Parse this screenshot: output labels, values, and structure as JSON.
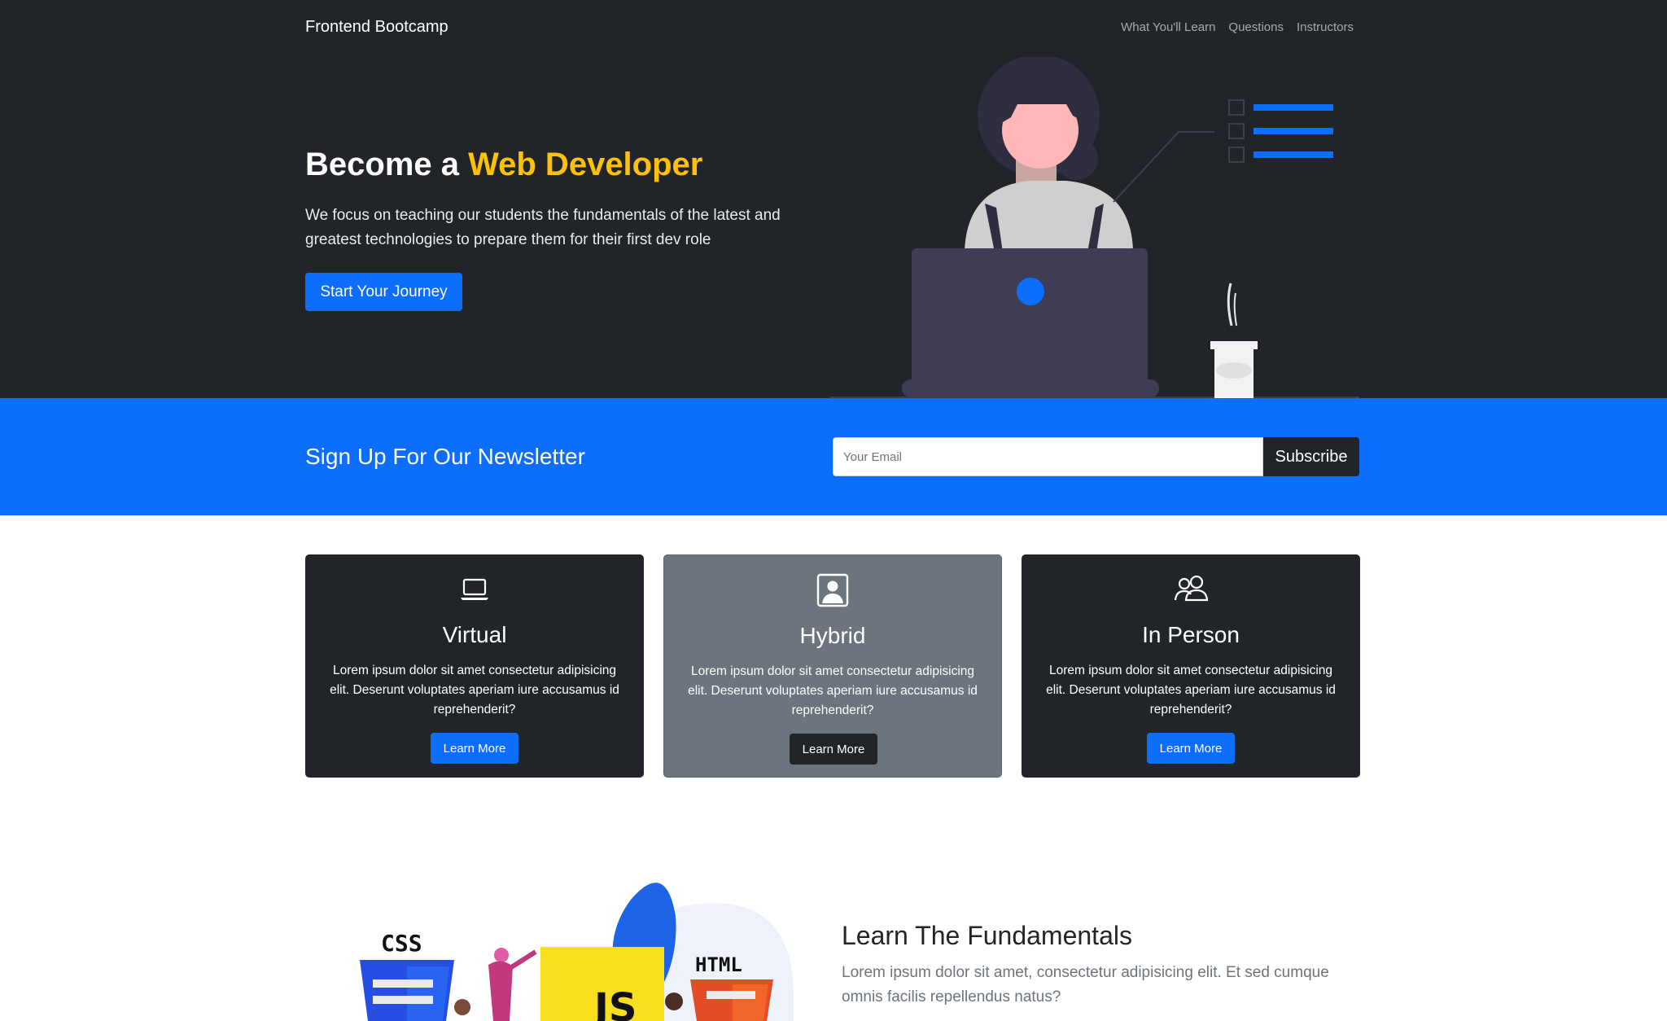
{
  "nav": {
    "brand": "Frontend Bootcamp",
    "links": [
      "What You'll Learn",
      "Questions",
      "Instructors"
    ]
  },
  "hero": {
    "title_prefix": "Become a ",
    "title_accent": "Web Developer",
    "text": "We focus on teaching our students the fundamentals of the latest and greatest technologies to prepare them for their first dev role",
    "button_label": "Start Your Journey"
  },
  "newsletter": {
    "title": "Sign Up For Our Newsletter",
    "email_placeholder": "Your Email",
    "email_value": "",
    "button_label": "Subscribe"
  },
  "cards": [
    {
      "icon": "laptop-icon",
      "title": "Virtual",
      "text": "Lorem ipsum dolor sit amet consectetur adipisicing elit. Deserunt voluptates aperiam iure accusamus id reprehenderit?",
      "button_label": "Learn More"
    },
    {
      "icon": "person-square-icon",
      "title": "Hybrid",
      "text": "Lorem ipsum dolor sit amet consectetur adipisicing elit. Deserunt voluptates aperiam iure accusamus id reprehenderit?",
      "button_label": "Learn More"
    },
    {
      "icon": "people-icon",
      "title": "In Person",
      "text": "Lorem ipsum dolor sit amet consectetur adipisicing elit. Deserunt voluptates aperiam iure accusamus id reprehenderit?",
      "button_label": "Learn More"
    }
  ],
  "learn": {
    "title": "Learn The Fundamentals",
    "text": "Lorem ipsum dolor sit amet, consectetur adipisicing elit. Et sed cumque omnis facilis repellendus natus?",
    "illustration_labels": {
      "css": "CSS",
      "html": "HTML",
      "js": "JS"
    }
  },
  "colors": {
    "dark": "#212529",
    "primary": "#0d6efd",
    "accent": "#ffc107",
    "secondary": "#6c757d"
  }
}
